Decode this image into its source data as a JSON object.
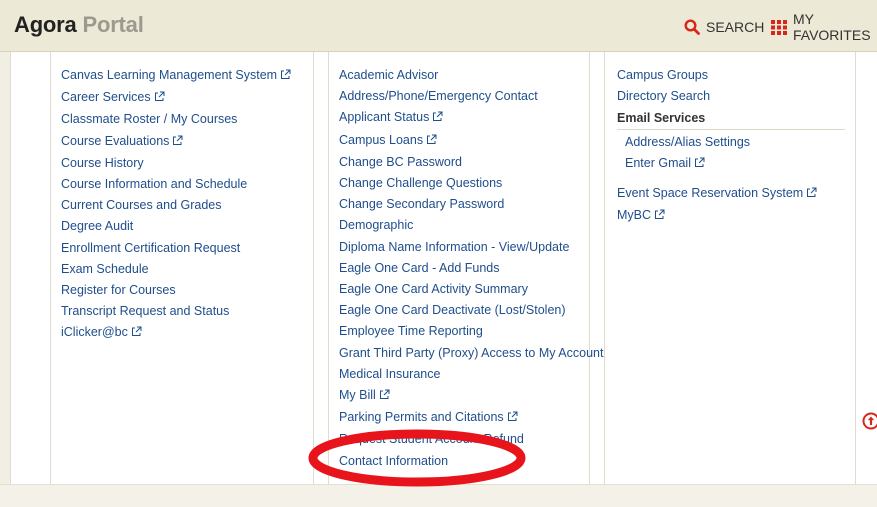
{
  "header": {
    "brand_main": "Agora",
    "brand_sub": "Portal",
    "search_label": "SEARCH",
    "favorites_label": "MY FAVORITES"
  },
  "columns": {
    "left": [
      {
        "label": "Canvas Learning Management System",
        "external": true
      },
      {
        "label": "Career Services",
        "external": true
      },
      {
        "label": "Classmate Roster / My Courses",
        "external": false
      },
      {
        "label": "Course Evaluations",
        "external": true
      },
      {
        "label": "Course History",
        "external": false
      },
      {
        "label": "Course Information and Schedule",
        "external": false
      },
      {
        "label": "Current Courses and Grades",
        "external": false
      },
      {
        "label": "Degree Audit",
        "external": false
      },
      {
        "label": "Enrollment Certification Request",
        "external": false
      },
      {
        "label": "Exam Schedule",
        "external": false
      },
      {
        "label": "Register for Courses",
        "external": false
      },
      {
        "label": "Transcript Request and Status",
        "external": false
      },
      {
        "label": "iClicker@bc",
        "external": true
      }
    ],
    "middle": [
      {
        "label": "Academic Advisor",
        "external": false
      },
      {
        "label": "Address/Phone/Emergency Contact",
        "external": false
      },
      {
        "label": "Applicant Status",
        "external": true
      },
      {
        "label": "Campus Loans",
        "external": true
      },
      {
        "label": "Change BC Password",
        "external": false
      },
      {
        "label": "Change Challenge Questions",
        "external": false
      },
      {
        "label": "Change Secondary Password",
        "external": false
      },
      {
        "label": "Demographic",
        "external": false
      },
      {
        "label": "Diploma Name Information - View/Update",
        "external": false
      },
      {
        "label": "Eagle One Card - Add Funds",
        "external": false
      },
      {
        "label": "Eagle One Card Activity Summary",
        "external": false
      },
      {
        "label": "Eagle One Card Deactivate (Lost/Stolen)",
        "external": false
      },
      {
        "label": "Employee Time Reporting",
        "external": false
      },
      {
        "label": "Grant Third Party (Proxy) Access to My Account",
        "external": false
      },
      {
        "label": "Medical Insurance",
        "external": false
      },
      {
        "label": "My Bill",
        "external": true
      },
      {
        "label": "Parking Permits and Citations",
        "external": true
      },
      {
        "label": "",
        "external": false
      },
      {
        "label": "Request Student Account Refund",
        "external": false
      },
      {
        "label": "Contact Information",
        "external": false
      }
    ],
    "right": {
      "top_items": [
        {
          "label": "Campus Groups",
          "external": false
        },
        {
          "label": "Directory Search",
          "external": false
        }
      ],
      "section_title": "Email Services",
      "section_items": [
        {
          "label": "Address/Alias Settings",
          "external": false
        },
        {
          "label": "Enter Gmail",
          "external": true
        }
      ],
      "bottom_items": [
        {
          "label": "Event Space Reservation System",
          "external": true
        },
        {
          "label": "MyBC",
          "external": true
        }
      ]
    }
  },
  "colors": {
    "link": "#1f4e8c",
    "header_bg": "#ece9d6",
    "accent_red": "#d9261c",
    "highlight_ring": "#e8141c"
  },
  "icons": {
    "search": "search-icon",
    "favorites": "grid-icon",
    "external": "external-link-icon",
    "scroll_top": "arrow-up-circle-icon"
  }
}
